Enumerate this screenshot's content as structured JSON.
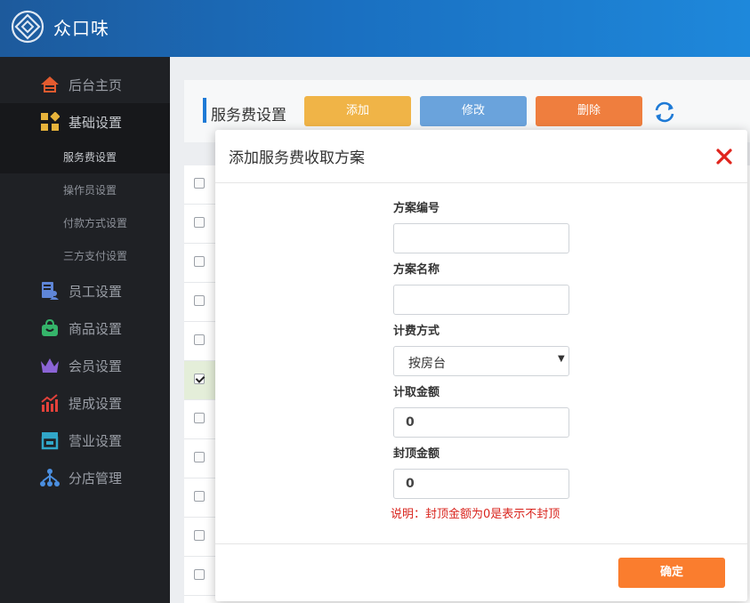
{
  "app": {
    "title": "众口味",
    "logo_icon": "diamond-logo-icon"
  },
  "sidebar": {
    "items": [
      {
        "label": "后台主页",
        "icon": "house-icon"
      },
      {
        "label": "基础设置",
        "icon": "blocks-icon"
      },
      {
        "label": "员工设置",
        "icon": "staff-card-icon"
      },
      {
        "label": "商品设置",
        "icon": "shopping-bag-icon"
      },
      {
        "label": "会员设置",
        "icon": "crown-icon"
      },
      {
        "label": "提成设置",
        "icon": "trend-up-icon"
      },
      {
        "label": "营业设置",
        "icon": "store-icon"
      },
      {
        "label": "分店管理",
        "icon": "branch-tree-icon"
      }
    ],
    "subitems": [
      {
        "label": "服务费设置",
        "active": true
      },
      {
        "label": "操作员设置",
        "active": false
      },
      {
        "label": "付款方式设置",
        "active": false
      },
      {
        "label": "三方支付设置",
        "active": false
      }
    ]
  },
  "toolbar": {
    "title": "服务费设置",
    "add_label": "添加",
    "edit_label": "修改",
    "delete_label": "删除",
    "refresh_icon": "refresh-icon"
  },
  "table": {
    "rows": [
      {
        "checked": false
      },
      {
        "checked": false
      },
      {
        "checked": false
      },
      {
        "checked": false
      },
      {
        "checked": false
      },
      {
        "checked": true
      },
      {
        "checked": false
      },
      {
        "checked": false
      },
      {
        "checked": false
      },
      {
        "checked": false
      },
      {
        "checked": false
      }
    ]
  },
  "modal": {
    "title": "添加服务费收取方案",
    "fields": {
      "code_label": "方案编号",
      "code_value": "",
      "name_label": "方案名称",
      "name_value": "",
      "billing_label": "计费方式",
      "billing_value": "按房台",
      "amount_label": "计取金额",
      "amount_value": "0",
      "cap_label": "封顶金额",
      "cap_value": "0"
    },
    "note": "说明：封顶金额为0是表示不封顶",
    "confirm_label": "确定"
  },
  "colors": {
    "header_blue": "#1a6fc0",
    "add_yellow": "#f0b447",
    "edit_blue": "#6aa3dc",
    "delete_orange": "#ef7e3e",
    "confirm_orange": "#fa7d2e",
    "close_red": "#e0241c",
    "note_red": "#d9241d"
  }
}
